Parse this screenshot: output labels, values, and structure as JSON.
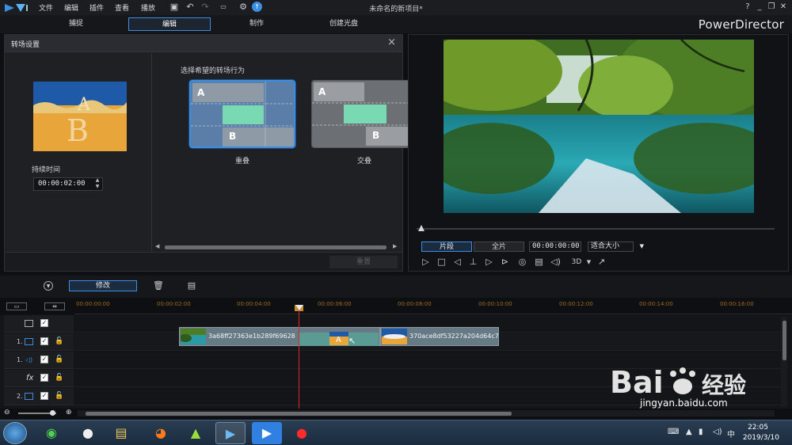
{
  "window": {
    "title": "未命名的新项目*",
    "brand": "PowerDirector"
  },
  "menu": [
    "文件",
    "编辑",
    "插件",
    "查看",
    "播放"
  ],
  "modes": {
    "capture": "捕捉",
    "edit": "编辑",
    "produce": "制作",
    "disc": "创建光盘"
  },
  "transition": {
    "title": "转场设置",
    "duration_label": "持续时间",
    "duration_value": "00:00:02:00",
    "behavior_label": "选择希望的转场行为",
    "options": [
      {
        "name": "重叠",
        "a": "A",
        "b": "B",
        "selected": true
      },
      {
        "name": "交叠",
        "a": "A",
        "b": "B",
        "selected": false
      }
    ],
    "reset_label": "重置"
  },
  "preview": {
    "tab_clip": "片段",
    "tab_movie": "全片",
    "time": "00:00:00:00",
    "fit": "适合大小",
    "mode_3d": "3D"
  },
  "timeline": {
    "modify_label": "修改",
    "ruler": [
      "00:00:00:00",
      "00:00:02:00",
      "00:00:04:00",
      "00:00:06:00",
      "00:00:08:00",
      "00:00:10:00",
      "00:00:12:00",
      "00:00:14:00",
      "00:00:16:00"
    ],
    "tracks": [
      {
        "num": "",
        "icon": "video-icon"
      },
      {
        "num": "1.",
        "icon": "video-icon"
      },
      {
        "num": "1.",
        "icon": "audio-icon"
      },
      {
        "num": "",
        "icon": "fx-icon",
        "label": "fx"
      },
      {
        "num": "2.",
        "icon": "video-icon"
      }
    ],
    "clips": [
      {
        "name": "3a68ff27363e1b289f69628"
      },
      {
        "name": "370ace8df53227a204d64c7"
      }
    ]
  },
  "taskbar": {
    "time": "22:05",
    "date": "2019/3/10"
  },
  "watermark": {
    "logo": "Bai 经验",
    "url": "jingyan.baidu.com"
  },
  "colors": {
    "accent": "#3c8fe0",
    "playhead": "#d52a2a",
    "clip": "#667a85",
    "transition": "#5a9b94"
  }
}
